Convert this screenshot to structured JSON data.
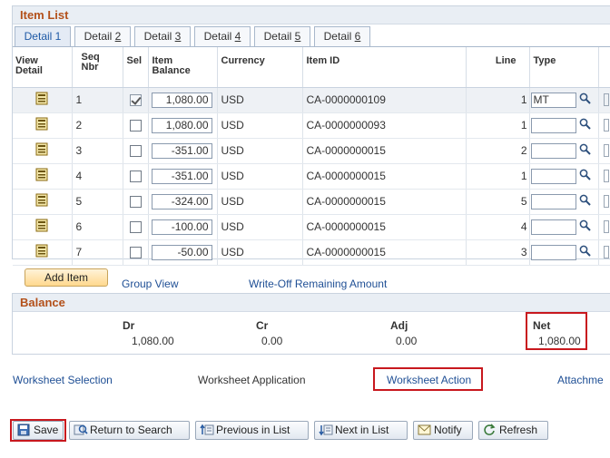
{
  "item_list": {
    "title": "Item List",
    "tabs": [
      {
        "pre": "Detail ",
        "key": "1",
        "post": ""
      },
      {
        "pre": "Detail ",
        "key": "2",
        "post": ""
      },
      {
        "pre": "Detail ",
        "key": "3",
        "post": ""
      },
      {
        "pre": "Detail ",
        "key": "4",
        "post": ""
      },
      {
        "pre": "Detail ",
        "key": "5",
        "post": ""
      },
      {
        "pre": "Detail ",
        "key": "6",
        "post": ""
      }
    ],
    "columns": {
      "view_detail": "View Detail",
      "seq": "Seq",
      "nbr": "Nbr",
      "sel": "Sel",
      "item_balance": "Item Balance",
      "currency": "Currency",
      "item_id": "Item ID",
      "line": "Line",
      "type": "Type"
    },
    "rows": [
      {
        "seq": "1",
        "selected": true,
        "balance": "1,080.00",
        "currency": "USD",
        "item_id": "CA-0000000109",
        "line": "1",
        "type": "MT"
      },
      {
        "seq": "2",
        "selected": false,
        "balance": "1,080.00",
        "currency": "USD",
        "item_id": "CA-0000000093",
        "line": "1",
        "type": ""
      },
      {
        "seq": "3",
        "selected": false,
        "balance": "-351.00",
        "currency": "USD",
        "item_id": "CA-0000000015",
        "line": "2",
        "type": ""
      },
      {
        "seq": "4",
        "selected": false,
        "balance": "-351.00",
        "currency": "USD",
        "item_id": "CA-0000000015",
        "line": "1",
        "type": ""
      },
      {
        "seq": "5",
        "selected": false,
        "balance": "-324.00",
        "currency": "USD",
        "item_id": "CA-0000000015",
        "line": "5",
        "type": ""
      },
      {
        "seq": "6",
        "selected": false,
        "balance": "-100.00",
        "currency": "USD",
        "item_id": "CA-0000000015",
        "line": "4",
        "type": ""
      },
      {
        "seq": "7",
        "selected": false,
        "balance": "-50.00",
        "currency": "USD",
        "item_id": "CA-0000000015",
        "line": "3",
        "type": ""
      }
    ]
  },
  "actions": {
    "add_item": "Add Item",
    "group_view": "Group View",
    "write_off": "Write-Off Remaining Amount"
  },
  "balance": {
    "title": "Balance",
    "dr_label": "Dr",
    "dr_value": "1,080.00",
    "cr_label": "Cr",
    "cr_value": "0.00",
    "adj_label": "Adj",
    "adj_value": "0.00",
    "net_label": "Net",
    "net_value": "1,080.00"
  },
  "page_links": {
    "selection": "Worksheet Selection",
    "application": "Worksheet Application",
    "action": "Worksheet Action",
    "attachments": "Attachme"
  },
  "toolbar": {
    "save": "Save",
    "return_to_search": "Return to Search",
    "previous_in_list": "Previous in List",
    "next_in_list": "Next in List",
    "notify": "Notify",
    "refresh": "Refresh"
  },
  "colors": {
    "header_text": "#b3501a",
    "link": "#1f4f95",
    "highlight": "#c8181e",
    "add_button": "#ffd88e"
  }
}
